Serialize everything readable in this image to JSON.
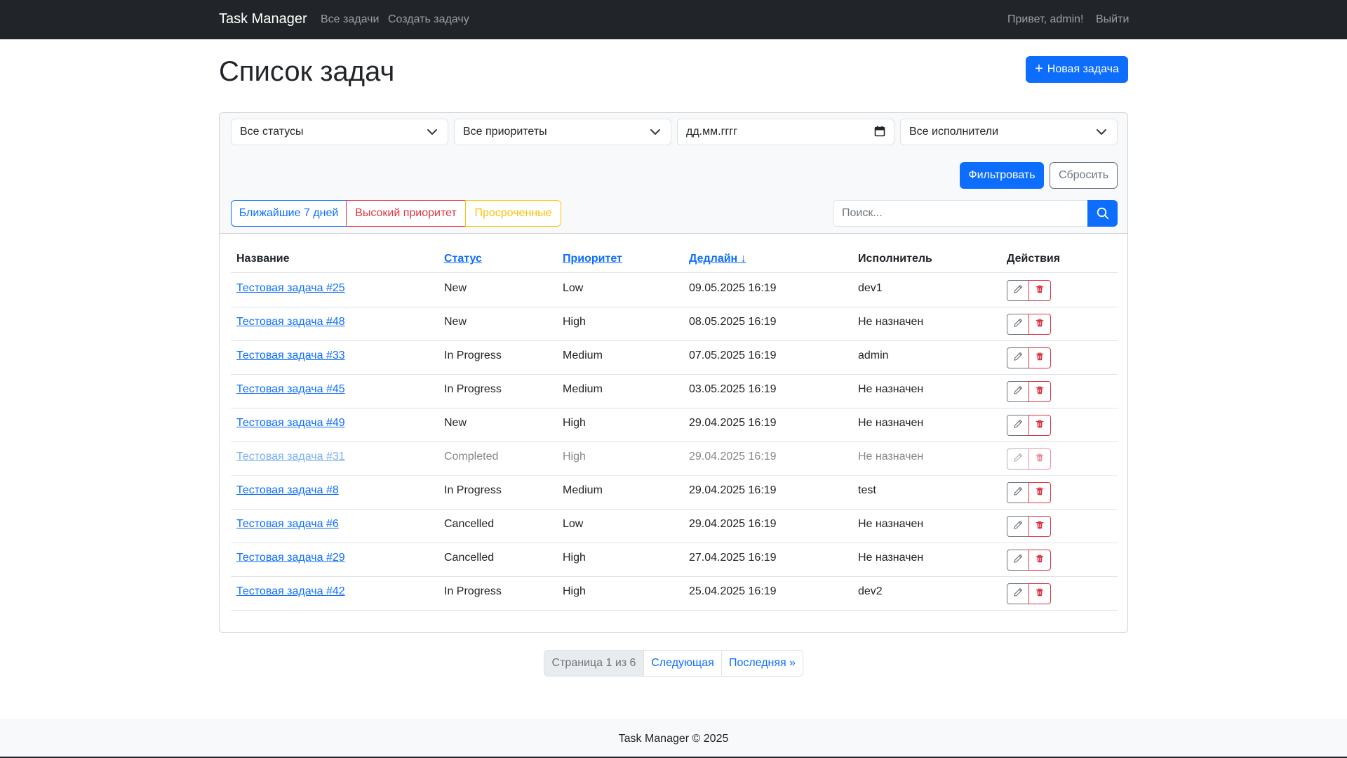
{
  "nav": {
    "brand": "Task Manager",
    "all_tasks": "Все задачи",
    "create_task": "Создать задачу",
    "greeting": "Привет, admin!",
    "logout": "Выйти"
  },
  "page": {
    "title": "Список задач",
    "new_task_label": "Новая задача"
  },
  "filters": {
    "status": "Все статусы",
    "priority": "Все приоритеты",
    "date_placeholder": "дд.мм.гггг",
    "assignee": "Все исполнители",
    "filter_label": "Фильтровать",
    "reset_label": "Сбросить",
    "quick_week": "Ближайшие 7 дней",
    "quick_high": "Высокий приоритет",
    "quick_overdue": "Просроченные",
    "search_placeholder": "Поиск..."
  },
  "table": {
    "headers": {
      "title": "Название",
      "status": "Статус",
      "priority": "Приоритет",
      "deadline": "Дедлайн ↓",
      "assignee": "Исполнитель",
      "actions": "Действия"
    },
    "rows": [
      {
        "title": "Тестовая задача #25",
        "status": "New",
        "priority": "Low",
        "deadline": "09.05.2025 16:19",
        "assignee": "dev1",
        "faded": false
      },
      {
        "title": "Тестовая задача #48",
        "status": "New",
        "priority": "High",
        "deadline": "08.05.2025 16:19",
        "assignee": "Не назначен",
        "faded": false
      },
      {
        "title": "Тестовая задача #33",
        "status": "In Progress",
        "priority": "Medium",
        "deadline": "07.05.2025 16:19",
        "assignee": "admin",
        "faded": false
      },
      {
        "title": "Тестовая задача #45",
        "status": "In Progress",
        "priority": "Medium",
        "deadline": "03.05.2025 16:19",
        "assignee": "Не назначен",
        "faded": false
      },
      {
        "title": "Тестовая задача #49",
        "status": "New",
        "priority": "High",
        "deadline": "29.04.2025 16:19",
        "assignee": "Не назначен",
        "faded": false
      },
      {
        "title": "Тестовая задача #31",
        "status": "Completed",
        "priority": "High",
        "deadline": "29.04.2025 16:19",
        "assignee": "Не назначен",
        "faded": true
      },
      {
        "title": "Тестовая задача #8",
        "status": "In Progress",
        "priority": "Medium",
        "deadline": "29.04.2025 16:19",
        "assignee": "test",
        "faded": false
      },
      {
        "title": "Тестовая задача #6",
        "status": "Cancelled",
        "priority": "Low",
        "deadline": "29.04.2025 16:19",
        "assignee": "Не назначен",
        "faded": false
      },
      {
        "title": "Тестовая задача #29",
        "status": "Cancelled",
        "priority": "High",
        "deadline": "27.04.2025 16:19",
        "assignee": "Не назначен",
        "faded": false
      },
      {
        "title": "Тестовая задача #42",
        "status": "In Progress",
        "priority": "High",
        "deadline": "25.04.2025 16:19",
        "assignee": "dev2",
        "faded": false
      }
    ]
  },
  "pagination": {
    "info": "Страница 1 из 6",
    "next": "Следующая",
    "last": "Последняя »"
  },
  "footer": {
    "text": "Task Manager © 2025"
  }
}
